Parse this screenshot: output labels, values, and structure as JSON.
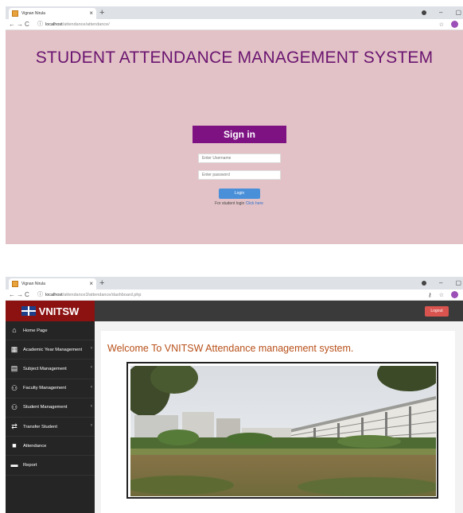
{
  "login_window": {
    "tab_title": "Vignan Nirula",
    "url_host": "localhost",
    "url_path": "/attendance/attendance/",
    "app_title": "STUDENT ATTENDANCE MANAGEMENT SYSTEM",
    "signin_label": "Sign in",
    "username_placeholder": "Enter Username",
    "password_placeholder": "Enter password",
    "login_button": "Login",
    "student_login_text": "For student login",
    "student_login_link": "Click here"
  },
  "dashboard_window": {
    "tab_title": "Vignan Nirula",
    "url_host": "localhost",
    "url_path": "/attendance3/attendance/dashboard.php",
    "brand": "VNITSW",
    "logout_label": "Logout",
    "welcome": "Welcome To VNITSW Attendance management system.",
    "sidebar": [
      {
        "label": "Home Page",
        "icon": "home-icon",
        "caret": false
      },
      {
        "label": "Academic Year Management",
        "icon": "calendar-icon",
        "caret": true
      },
      {
        "label": "Subject Management",
        "icon": "book-icon",
        "caret": true
      },
      {
        "label": "Faculty Management",
        "icon": "users-icon",
        "caret": true
      },
      {
        "label": "Student Management",
        "icon": "users-icon",
        "caret": true
      },
      {
        "label": "Transfer Student",
        "icon": "transfer-icon",
        "caret": true
      },
      {
        "label": "Attendance",
        "icon": "file-icon",
        "caret": false
      },
      {
        "label": "Report",
        "icon": "folder-icon",
        "caret": false
      }
    ]
  },
  "colors": {
    "login_bg": "#e2c2c6",
    "title_purple": "#6a1470",
    "signin_bg": "#7e1283",
    "login_button": "#4a90d9",
    "brand_red": "#8c1212",
    "sidebar_bg": "#252525",
    "logout_red": "#d9534f",
    "welcome_orange": "#b8501a"
  }
}
